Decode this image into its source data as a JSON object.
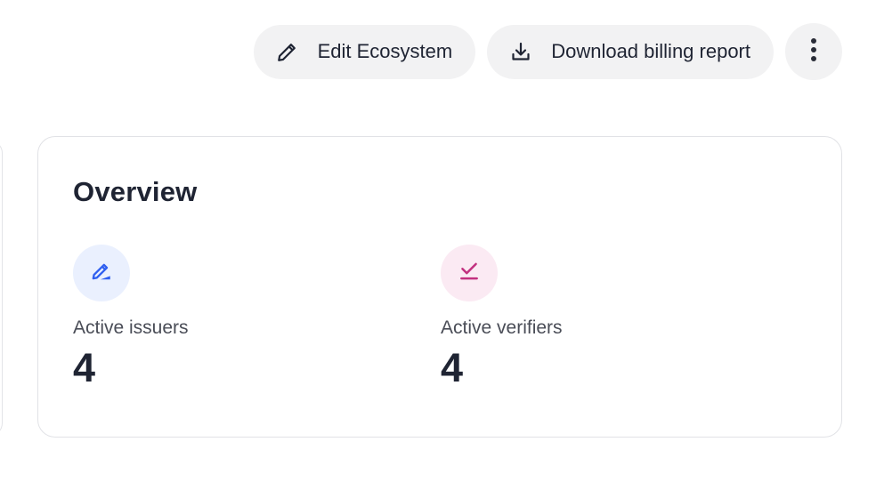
{
  "toolbar": {
    "edit_label": "Edit Ecosystem",
    "download_label": "Download billing report",
    "edit_icon": "pencil-icon",
    "download_icon": "download-icon",
    "more_icon": "more-vertical-icon"
  },
  "overview": {
    "title": "Overview",
    "issuers": {
      "label": "Active issuers",
      "value": "4",
      "icon": "sign-pen-icon",
      "accent": "#2f5ff0"
    },
    "verifiers": {
      "label": "Active verifiers",
      "value": "4",
      "icon": "check-underline-icon",
      "accent": "#c2307f"
    }
  }
}
